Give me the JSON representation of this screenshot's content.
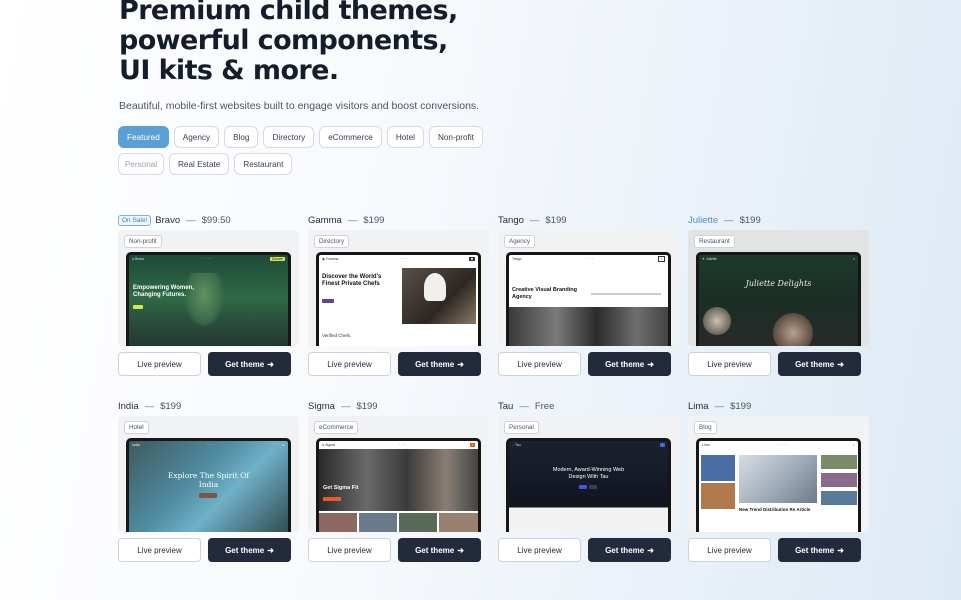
{
  "hero": {
    "line1": "Premium child themes,",
    "line2": "powerful components,",
    "line3": "UI kits & more.",
    "subtitle": "Beautiful, mobile-first websites built to engage visitors and boost conversions."
  },
  "filters": {
    "row1": [
      "Featured",
      "Agency",
      "Blog",
      "Directory",
      "eCommerce",
      "Hotel",
      "Non-profit"
    ],
    "row2": [
      "Personal",
      "Real Estate",
      "Restaurant"
    ],
    "active": "Featured"
  },
  "labels": {
    "preview": "Live preview",
    "get": "Get theme",
    "dash": "—"
  },
  "themes": [
    {
      "name": "Bravo",
      "price": "$99.50",
      "badge": "On Sale!",
      "tag": "Non-profit",
      "headline": "Empowering Women, Changing Futures."
    },
    {
      "name": "Gamma",
      "price": "$199",
      "tag": "Directory",
      "headline": "Discover the World's Finest Private Chefs",
      "footer": "Verified Chefs."
    },
    {
      "name": "Tango",
      "price": "$199",
      "tag": "Agency",
      "headline": "Creative Visual Branding Agency"
    },
    {
      "name": "Juliette",
      "price": "$199",
      "tag": "Restaurant",
      "headline": "Juliette Delights"
    },
    {
      "name": "India",
      "price": "$199",
      "tag": "Hotel",
      "headline": "Explore The Spirit Of India"
    },
    {
      "name": "Sigma",
      "price": "$199",
      "tag": "eCommerce",
      "headline": "Get Sigma Fit"
    },
    {
      "name": "Tau",
      "price": "Free",
      "tag": "Personal",
      "headline": "Modern, Award-Winning Web Design With Tau"
    },
    {
      "name": "Lima",
      "price": "$199",
      "tag": "Blog",
      "headline": "New Trend Distribution Re Article"
    }
  ],
  "colors": {
    "accent": "#5a9fd6",
    "dark_button": "#232a3b",
    "juliette_name": "#4a8fd0"
  },
  "icons": {
    "get_theme_arrow": "arrow-right-icon"
  }
}
